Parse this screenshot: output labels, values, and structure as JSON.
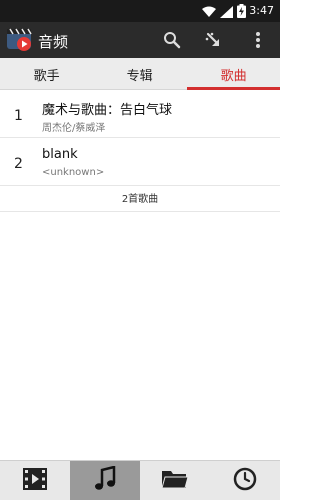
{
  "status_bar": {
    "time": "3:47",
    "icons": [
      "wifi-icon",
      "signal-icon",
      "battery-charging-icon"
    ]
  },
  "app_bar": {
    "title": "音频",
    "logo": "app-logo-icon",
    "actions": [
      "search-icon",
      "sort-icon",
      "more-vert-icon"
    ]
  },
  "tabs": [
    {
      "label": "歌手",
      "active": false
    },
    {
      "label": "专辑",
      "active": false
    },
    {
      "label": "歌曲",
      "active": true
    }
  ],
  "songs": [
    {
      "index": "1",
      "title": "魔术与歌曲：告白气球",
      "artist": "周杰伦/蔡威泽"
    },
    {
      "index": "2",
      "title": "blank",
      "artist": "<unknown>"
    }
  ],
  "song_count": "2首歌曲",
  "bottom_nav": [
    {
      "icon": "video-icon",
      "active": false
    },
    {
      "icon": "music-note-icon",
      "active": true
    },
    {
      "icon": "folder-icon",
      "active": false
    },
    {
      "icon": "history-icon",
      "active": false
    }
  ],
  "colors": {
    "accent": "#d32f2f",
    "app_bar": "#2b2b2b",
    "status_bar": "#1a1a1a",
    "tab_bar": "#ececec",
    "nav_active": "#9a9a9a"
  }
}
